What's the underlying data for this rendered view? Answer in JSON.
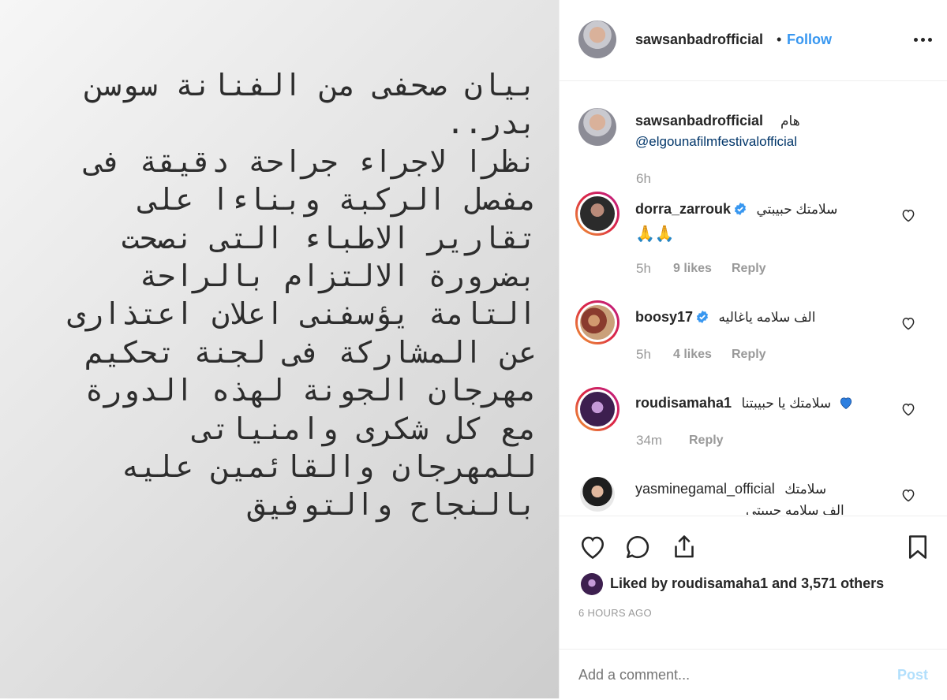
{
  "post_image": {
    "text": "بيان صحفى من الفنانة سوسن بدر..\nنظرا لاجراء جراحة دقيقة فى مفصل الركبة وبناءا على تقارير الاطباء التى نصحت بضرورة الالتزام بالراحة التامة يؤسفنى اعلان اعتذارى عن المشاركة فى لجنة تحكيم مهرجان الجونة لهذه الدورة مع كل شكرى وامنياتى للمهرجان والقائمين عليه بالنجاح والتوفيق"
  },
  "header": {
    "username": "sawsanbadrofficial",
    "separator": "•",
    "follow_label": "Follow",
    "more_icon": "more-horizontal-icon"
  },
  "caption": {
    "username": "sawsanbadrofficial",
    "text": "هام",
    "mention": "@elgounafilmfestivalofficial",
    "time": "6h"
  },
  "comments": [
    {
      "username": "dorra_zarrouk",
      "verified": true,
      "text": "سلامتك حبيبتي",
      "emoji": "🙏🙏",
      "time": "5h",
      "likes": "9 likes",
      "reply": "Reply"
    },
    {
      "username": "boosy17",
      "verified": true,
      "text": "الف سلامه ياغاليه",
      "time": "5h",
      "likes": "4 likes",
      "reply": "Reply"
    },
    {
      "username": "roudisamaha1",
      "verified": false,
      "text": "سلامتك يا حبيبتنا",
      "time": "34m",
      "reply": "Reply"
    },
    {
      "username": "yasminegamal_official",
      "verified": false,
      "text": "سلامتك",
      "text2": "الف سلامه حبيبتي"
    }
  ],
  "actions": {
    "icons": [
      "heart-icon",
      "comment-icon",
      "share-icon",
      "bookmark-icon"
    ],
    "liked_by_prefix": "Liked by",
    "liked_by_user": "roudisamaha1",
    "liked_by_and": "and",
    "liked_by_others": "3,571 others",
    "timestamp": "6 HOURS AGO"
  },
  "add_comment": {
    "placeholder": "Add a comment...",
    "post_label": "Post"
  },
  "colors": {
    "accent": "#3897f0",
    "mention": "#003569",
    "muted": "#999999",
    "verified": "#3897f0"
  }
}
